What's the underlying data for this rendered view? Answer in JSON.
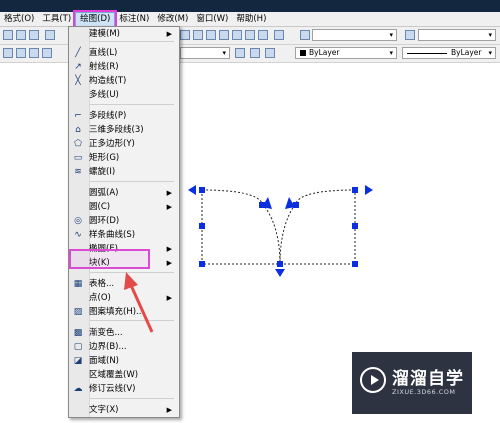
{
  "menubar": {
    "items": [
      "格式(O)",
      "工具(T)",
      "绘图(D)",
      "标注(N)",
      "修改(M)",
      "窗口(W)",
      "帮助(H)"
    ],
    "active": "绘图(D)"
  },
  "toolbar": {
    "layer_select": "ByLayer",
    "linetype_select": "ByLayer"
  },
  "draw_menu": {
    "items": [
      {
        "label": "建模(M)",
        "icon": "none",
        "has_submenu": true
      },
      {
        "label": "直线(L)",
        "icon": "line-icon"
      },
      {
        "label": "射线(R)",
        "icon": "ray-icon"
      },
      {
        "label": "构造线(T)",
        "icon": "construction-line-icon"
      },
      {
        "label": "多线(U)",
        "icon": "none"
      },
      {
        "label": "多段线(P)",
        "icon": "polyline-icon"
      },
      {
        "label": "三维多段线(3)",
        "icon": "3d-polyline-icon"
      },
      {
        "label": "正多边形(Y)",
        "icon": "polygon-icon"
      },
      {
        "label": "矩形(G)",
        "icon": "rectangle-icon"
      },
      {
        "label": "螺旋(I)",
        "icon": "helix-icon"
      },
      {
        "label": "圆弧(A)",
        "icon": "none",
        "has_submenu": true
      },
      {
        "label": "圆(C)",
        "icon": "none",
        "has_submenu": true
      },
      {
        "label": "圆环(D)",
        "icon": "donut-icon"
      },
      {
        "label": "样条曲线(S)",
        "icon": "spline-icon"
      },
      {
        "label": "椭圆(E)",
        "icon": "none",
        "has_submenu": true
      },
      {
        "label": "块(K)",
        "icon": "none",
        "has_submenu": true,
        "highlighted": true
      },
      {
        "label": "表格...",
        "icon": "table-icon"
      },
      {
        "label": "点(O)",
        "icon": "none",
        "has_submenu": true
      },
      {
        "label": "图案填充(H)...",
        "icon": "hatch-icon"
      },
      {
        "label": "渐变色...",
        "icon": "gradient-icon"
      },
      {
        "label": "边界(B)...",
        "icon": "boundary-icon"
      },
      {
        "label": "面域(N)",
        "icon": "region-icon"
      },
      {
        "label": "区域覆盖(W)",
        "icon": "none"
      },
      {
        "label": "修订云线(V)",
        "icon": "revcloud-icon"
      },
      {
        "label": "文字(X)",
        "icon": "none",
        "has_submenu": true
      }
    ]
  },
  "watermark": {
    "title": "溜溜自学",
    "subtitle": "ZIXUE.3D66.COM"
  },
  "colors": {
    "highlight_border": "#d94bd3",
    "arrow": "#e34b4b",
    "grip": "#0a2ee0"
  }
}
